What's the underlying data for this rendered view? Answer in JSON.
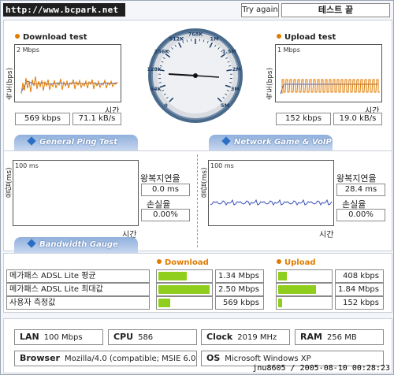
{
  "top": {
    "url": "http://www.bcpark.net",
    "try_again": "Try again",
    "test_done": "테스트 끝"
  },
  "download": {
    "title": "Download test",
    "ylabel": "속도(bps)",
    "scale": "2 Mbps",
    "xlabel": "시간",
    "value_kbps": "569 kbps",
    "value_kBs": "71.1 kB/s"
  },
  "upload": {
    "title": "Upload test",
    "ylabel": "속도(bps)",
    "scale": "1 Mbps",
    "xlabel": "시간",
    "value_kbps": "152 kbps",
    "value_kBs": "19.0 kB/s"
  },
  "speedometer": {
    "labels": [
      "0",
      "64K",
      "128K",
      "256K",
      "512K",
      "768K",
      "1M",
      "1.5M",
      "2M",
      "3M",
      "5M"
    ],
    "needle_value": "569 kbps"
  },
  "tabs": {
    "ping": "General Ping Test",
    "game": "Network Game & VoIP Test",
    "bandwidth": "Bandwidth Gauge"
  },
  "ping_left": {
    "ylabel": "응답(ms)",
    "scale": "100 ms",
    "xlabel": "시간",
    "rtt_label": "왕복지연율",
    "rtt_value": "0.0 ms",
    "loss_label": "손실율",
    "loss_value": "0.00%"
  },
  "ping_right": {
    "ylabel": "응답(ms)",
    "scale": "100 ms",
    "xlabel": "시간",
    "rtt_label": "왕복지연율",
    "rtt_value": "28.4 ms",
    "loss_label": "손실율",
    "loss_value": "0.00%"
  },
  "bandwidth": {
    "download_header": "Download",
    "upload_header": "Upload",
    "rows": [
      {
        "label": "메가패스 ADSL Lite 평균",
        "down": "1.34 Mbps",
        "down_frac": 0.54,
        "up": "408 kbps",
        "up_frac": 0.17
      },
      {
        "label": "메가패스 ADSL Lite 최대값",
        "down": "2.50 Mbps",
        "down_frac": 0.99,
        "up": "1.84 Mbps",
        "up_frac": 0.72
      },
      {
        "label": "사용자 측정값",
        "down": "569 kbps",
        "down_frac": 0.22,
        "up": "152 kbps",
        "up_frac": 0.08
      }
    ]
  },
  "sysinfo": {
    "lan_label": "LAN",
    "lan_value": "100 Mbps",
    "cpu_label": "CPU",
    "cpu_value": "586",
    "clock_label": "Clock",
    "clock_value": "2019 MHz",
    "ram_label": "RAM",
    "ram_value": "256 MB",
    "browser_label": "Browser",
    "browser_value": "Mozilla/4.0 (compatible; MSIE 6.0",
    "os_label": "OS",
    "os_value": "Microsoft Windows XP"
  },
  "stamp": "jnu8605 / 2005-08-10 00:28:23",
  "colors": {
    "accent": "#e07b00",
    "gauge": "#8fce1c",
    "tab": "#8fb0dc"
  }
}
